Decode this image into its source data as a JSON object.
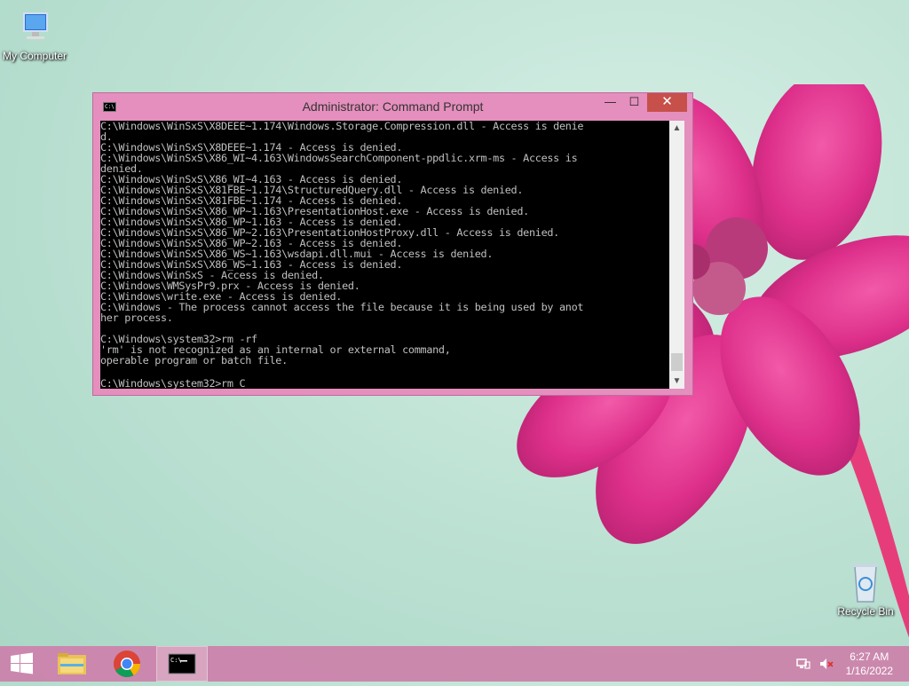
{
  "desktop": {
    "icons": [
      {
        "label": "My Computer",
        "icon": "computer-icon"
      },
      {
        "label": "Recycle Bin",
        "icon": "recycle-bin-icon"
      }
    ]
  },
  "window": {
    "title": "Administrator: Command Prompt",
    "icon": "cmd-icon",
    "controls": {
      "minimize": "—",
      "maximize": "☐",
      "close": "✕"
    }
  },
  "console": {
    "lines": [
      "C:\\Windows\\WinSxS\\X8DEEE~1.174\\Windows.Storage.Compression.dll - Access is denie",
      "d.",
      "C:\\Windows\\WinSxS\\X8DEEE~1.174 - Access is denied.",
      "C:\\Windows\\WinSxS\\X86_WI~4.163\\WindowsSearchComponent-ppdlic.xrm-ms - Access is",
      "denied.",
      "C:\\Windows\\WinSxS\\X86_WI~4.163 - Access is denied.",
      "C:\\Windows\\WinSxS\\X81FBE~1.174\\StructuredQuery.dll - Access is denied.",
      "C:\\Windows\\WinSxS\\X81FBE~1.174 - Access is denied.",
      "C:\\Windows\\WinSxS\\X86_WP~1.163\\PresentationHost.exe - Access is denied.",
      "C:\\Windows\\WinSxS\\X86_WP~1.163 - Access is denied.",
      "C:\\Windows\\WinSxS\\X86_WP~2.163\\PresentationHostProxy.dll - Access is denied.",
      "C:\\Windows\\WinSxS\\X86_WP~2.163 - Access is denied.",
      "C:\\Windows\\WinSxS\\X86_WS~1.163\\wsdapi.dll.mui - Access is denied.",
      "C:\\Windows\\WinSxS\\X86_WS~1.163 - Access is denied.",
      "C:\\Windows\\WinSxS - Access is denied.",
      "C:\\Windows\\WMSysPr9.prx - Access is denied.",
      "C:\\Windows\\write.exe - Access is denied.",
      "C:\\Windows - The process cannot access the file because it is being used by anot",
      "her process.",
      "",
      "C:\\Windows\\system32>rm -rf",
      "'rm' is not recognized as an internal or external command,",
      "operable program or batch file.",
      ""
    ],
    "prompt_line": "C:\\Windows\\system32>rm C"
  },
  "taskbar": {
    "start_icon": "windows-start-icon",
    "pinned": [
      {
        "name": "file-explorer",
        "icon": "folder-icon"
      },
      {
        "name": "chrome",
        "icon": "chrome-icon"
      },
      {
        "name": "command-prompt",
        "icon": "cmd-icon",
        "active": true
      }
    ],
    "tray": {
      "network_icon": "network-icon",
      "volume_icon": "volume-muted-icon",
      "time": "6:27 AM",
      "date": "1/16/2022"
    }
  }
}
